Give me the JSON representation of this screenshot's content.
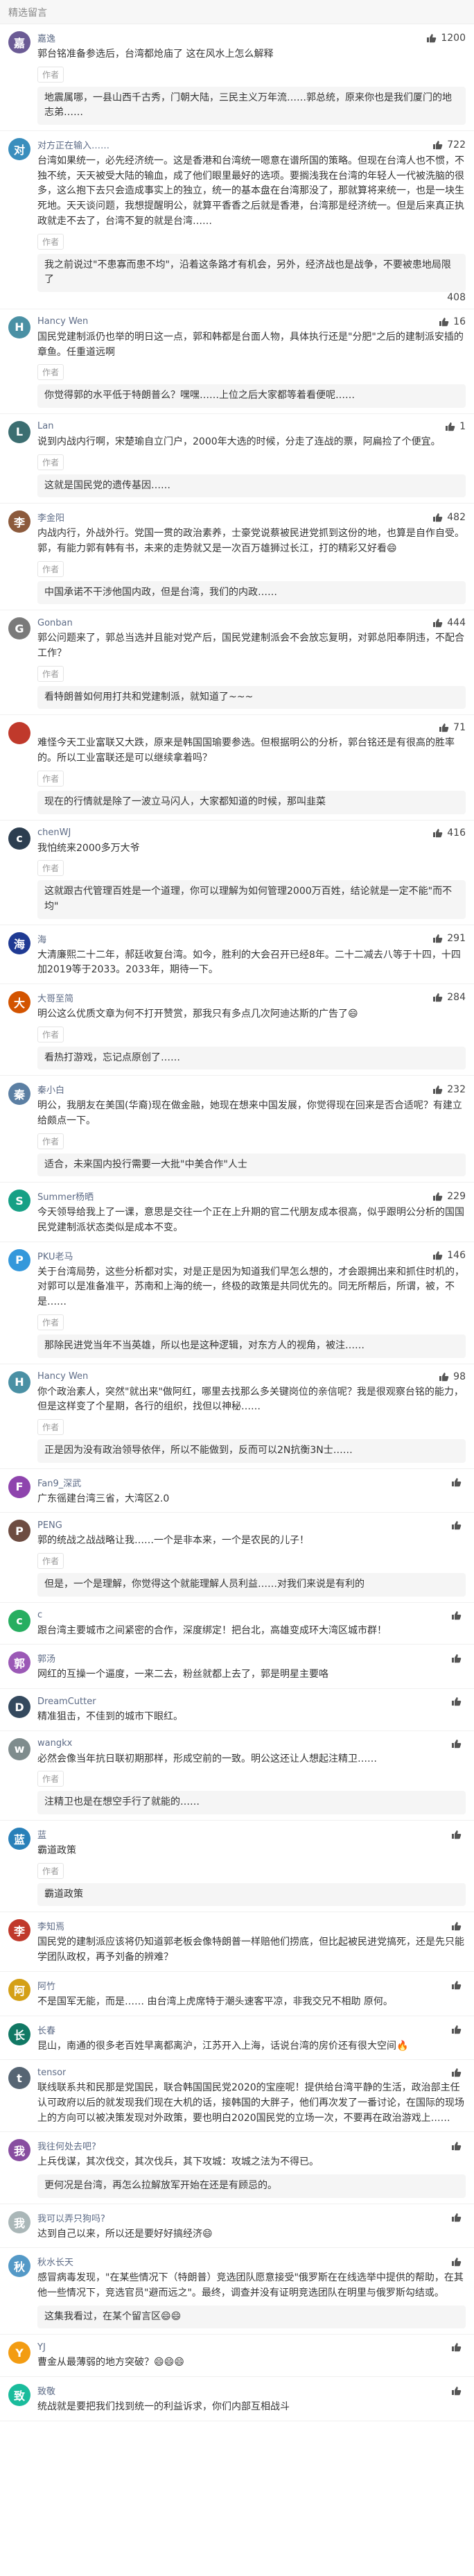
{
  "section_title": "精选留言",
  "colors": {
    "accent": "#5d6b86",
    "bg_section": "#f7f7f7"
  },
  "comments": [
    {
      "username": "嘉逸",
      "likes": "1200",
      "avatar_color": "#6b5b95",
      "content": "郭台铭准备参选后，台湾都炝庙了 这在风水上怎么解释",
      "author_tag": "作者",
      "reply": "地震属哪，一县山西千古秀，门朝大陆，三民主义万年流……郭总统，原来你也是我们厦门的地志弟……"
    },
    {
      "username": "对方正在输入……",
      "likes": "722",
      "avatar_color": "#3a8ebd",
      "content": "台湾如果统一，必先经济统一。这是香港和台湾统一嗯意在谱所国的策略。但现在台湾人也不惯，不独不统，天天被受大陆的输血，成了他们眼里最好的选项。要搁浅我在台湾的年轻人一代被洗脑的很多，这么抱下去只会造成事实上的独立，统一的基本盘在台湾那没了，那就算将来统一，也是一块生死地。天天谈问题，我想提醒明公，就算平香香之后就是香港，台湾那是经济统一。但是后来真正执政就走不去了，台湾不复的就是台湾……",
      "author_tag": "作者",
      "reply": "我之前说过\"不患寡而患不均\"，沿着这条路才有机会，另外，经济战也是战争，不要被患地局限了",
      "reply_likes": "408"
    },
    {
      "username": "Hancy Wen",
      "likes": "16",
      "avatar_color": "#4a90a4",
      "content": "国民党建制派仍也举的明日这一点，郭和韩都是台面人物，具体执行还是\"分肥\"之后的建制派安插的章鱼。任重道远啊",
      "author_tag": "作者",
      "reply": "你觉得郭的水平低于特朗普么？嘿嘿……上位之后大家都等着看便呢……"
    },
    {
      "username": "Lan",
      "likes": "1",
      "avatar_color": "#3c6e71",
      "content": "说到内战内行啊，宋楚瑜自立门户，2000年大选的时候，分走了连战的票，阿扁捡了个便宜。",
      "author_tag": "作者",
      "reply": "这就是国民党的遗传基因……"
    },
    {
      "username": "李金阳",
      "likes": "482",
      "avatar_color": "#8c5a3c",
      "content": "内战内行，外战外行。党国一贯的政治素养，士豪党说蔡被民进党抓到这份的地，也算是自作自受。郭，有能力郭有韩有书，未来的走势就又是一次百万雄狮过长江，打的精彩又好看😄",
      "author_tag": "作者",
      "reply": "中国承诺不干涉他国内政，但是台湾，我们的内政……"
    },
    {
      "username": "Gonban",
      "likes": "444",
      "avatar_color": "#7a7a7a",
      "content": "郭公问题来了，郭总当选并且能对党产后，国民党建制派会不会放忘复明，对郭总阳奉阴违，不配合工作？",
      "author_tag": "作者",
      "reply": "看特朗普如何用打共和党建制派，就知道了~~~"
    },
    {
      "username": "",
      "likes": "71",
      "avatar_color": "#c0392b",
      "content": "难怪今天工业富联又大跌，原来是韩国国瑜要参选。但根据明公的分析，郭台铭还是有很高的胜率的。所以工业富联还是可以继续拿着吗？",
      "author_tag": "作者",
      "reply": "现在的行情就是除了一波立马闪人，大家都知道的时候，那叫韭菜"
    },
    {
      "username": "chenWJ",
      "likes": "416",
      "avatar_color": "#2c3e50",
      "content": "我怕统来2000多万大爷",
      "author_tag": "作者",
      "reply": "这就跟古代管理百姓是一个道理，你可以理解为如何管理2000万百姓，结论就是一定不能\"而不均\""
    },
    {
      "username": "海",
      "likes": "291",
      "avatar_color": "#1f3a93",
      "content": "大清廉熙二十二年，郝廷收复台湾。如今，胜利的大会召开已经8年。二十二减去八等于十四，十四加2019等于2033。2033年，期待一下。",
      "author_tag": "",
      "reply": ""
    },
    {
      "username": "大哥至简",
      "likes": "284",
      "avatar_color": "#d35400",
      "content": "明公这么优质文章为何不打开赞赏，那我只有多点几次阿迪达斯的广告了😄",
      "author_tag": "作者",
      "reply": "看热打游戏，忘记点原创了……"
    },
    {
      "username": "秦小白",
      "likes": "232",
      "avatar_color": "#5b7fa3",
      "content": "明公，我朋友在美国(华裔)现在做金融，她现在想来中国发展，你觉得现在回来是否合适呢？有建立给颇点一下。",
      "author_tag": "作者",
      "reply": "适合，未来国内投行需要一大批\"中美合作\"人士"
    },
    {
      "username": "Summer杨晒",
      "likes": "229",
      "avatar_color": "#16a085",
      "content": "今天领导给我上了一课，意思是交往一个正在上升期的官二代朋友成本很高，似乎跟明公分析的国国民党建制派状态类似是成本不变。",
      "author_tag": "",
      "reply": ""
    },
    {
      "username": "PKU老马",
      "likes": "146",
      "avatar_color": "#3498db",
      "content": "关于台湾局势，这些分析都对实，对是正是因为知道我们早怎么想的，才会跟拥出来和抓住时机的，对郭可以是准备准平，苏南和上海的统一，终极的政策是共同优先的。同无所帮后，所谓，被，不是……",
      "author_tag": "作者",
      "reply": "那除民进党当年不当英雄，所以也是这种逻辑，对东方人的视角，被注……"
    },
    {
      "username": "Hancy Wen",
      "likes": "98",
      "avatar_color": "#4a90a4",
      "content": "你个政治素人，突然\"就出来\"做阿红，哪里去找那么多关键岗位的亲信呢？我是很观察台铭的能力，但是这样变了个星期，各行的组织，找但以神秘……",
      "author_tag": "作者",
      "reply": "正是因为没有政治领导依伴，所以不能做到，反而可以2N抗衡3N士……"
    },
    {
      "username": "Fan9_深武",
      "likes": "",
      "avatar_color": "#8e44ad",
      "content": "广东徭建台湾三省，大湾区2.0",
      "author_tag": "",
      "reply": ""
    },
    {
      "username": "PENG",
      "likes": "",
      "avatar_color": "#6d4c41",
      "content": "郭的统战之战战略让我……一个是非本来，一个是农民的儿子！",
      "author_tag": "作者",
      "reply": "但是，一个是理解，你觉得这个就能理解人员利益……对我们来说是有利的"
    },
    {
      "username": "c",
      "likes": "",
      "avatar_color": "#27ae60",
      "content": "跟台湾主要城市之间紧密的合作，深度绑定！把台北，高雄变成环大湾区城市群！",
      "author_tag": "",
      "reply": ""
    },
    {
      "username": "郭汤",
      "likes": "",
      "avatar_color": "#9b59b6",
      "content": "网红的互操一个逼度，一来二去，粉丝就都上去了，郭是明星主要咯",
      "author_tag": "",
      "reply": ""
    },
    {
      "username": "DreamCutter",
      "likes": "",
      "avatar_color": "#34495e",
      "content": "精准狙击，不佳到的城市下眼红。",
      "author_tag": "",
      "reply": ""
    },
    {
      "username": "wangkx",
      "likes": "",
      "avatar_color": "#7f8c8d",
      "content": "必然会像当年抗日联初期那样，形成空前的一致。明公这还让人想起注精卫……",
      "author_tag": "作者",
      "reply": "注精卫也是在想空手行了就能的……"
    },
    {
      "username": "蓝",
      "likes": "",
      "avatar_color": "#2980b9",
      "content": "霸道政策",
      "author_tag": "作者",
      "reply": "霸道政策"
    },
    {
      "username": "李知焉",
      "likes": "",
      "avatar_color": "#c0392b",
      "content": "国民党的建制派应该将仍知道郭老板会像特朗普一样赔他们捞底，但比起被民进党搞死，还是先只能学团队政权，再予刘备的辨难？",
      "author_tag": "",
      "reply": ""
    },
    {
      "username": "阿竹",
      "likes": "",
      "avatar_color": "#d4a017",
      "content": "不是国军无能，而是……\n由台湾上虎席特于潮头速客平凉，非我交兄不相助 原何。",
      "author_tag": "",
      "reply": ""
    },
    {
      "username": "长春",
      "likes": "",
      "avatar_color": "#117864",
      "content": "昆山，南通的很多老百姓早离都离沪，江苏开入上海，话说台湾的房价还有很大空间🔥",
      "author_tag": "",
      "reply": ""
    },
    {
      "username": "tensor",
      "likes": "",
      "avatar_color": "#566573",
      "content": "联线联系共和民那是党国民，联合韩国国民党2020的宝座呢！提供给台湾平静的生活，政治部主任认可政府以后的就发现我们现在大机的话，接韩国的大胖子，他们再次发了一番讨论，在国际的现场上的方向可以被决策发现对外政策，要也明白2020国民党的立场一次，不要再在政治游戏上……",
      "author_tag": "",
      "reply": ""
    },
    {
      "username": "我往何处去吧?",
      "likes": "",
      "avatar_color": "#884ea0",
      "content": "上兵伐谋，其次伐交，其次伐兵，其下攻城：攻城之法为不得已。",
      "author_tag": "",
      "reply": "更何况是台湾，再怎么拉解放军开始在还是有顾忌的。"
    },
    {
      "username": "我可以弄只狗吗?",
      "likes": "",
      "avatar_color": "#aab7b8",
      "content": "达到自己以来，所以还是要好好搞经济😄",
      "author_tag": "",
      "reply": ""
    },
    {
      "username": "秋水长天",
      "likes": "",
      "avatar_color": "#5499c7",
      "content": "感冒病毒发现，\"在某些情况下（特朗普）竞选团队愿意接受\"俄罗斯在在线选举中提供的帮助，在其他一些情况下，竞选官员\"避而远之\"。最终，调查并没有证明竞选团队在明里与俄罗斯勾结或。",
      "author_tag": "",
      "reply": "这集我看过，在某个留言区😄😄"
    },
    {
      "username": "YJ",
      "likes": "",
      "avatar_color": "#f39c12",
      "content": "曹金从最薄弱的地方突破？😄😄😄",
      "author_tag": "",
      "reply": ""
    },
    {
      "username": "致敬",
      "likes": "",
      "avatar_color": "#1abc9c",
      "content": "统战就是要把我们找到统一的利益诉求，你们内部互相战斗",
      "author_tag": "",
      "reply": ""
    }
  ]
}
